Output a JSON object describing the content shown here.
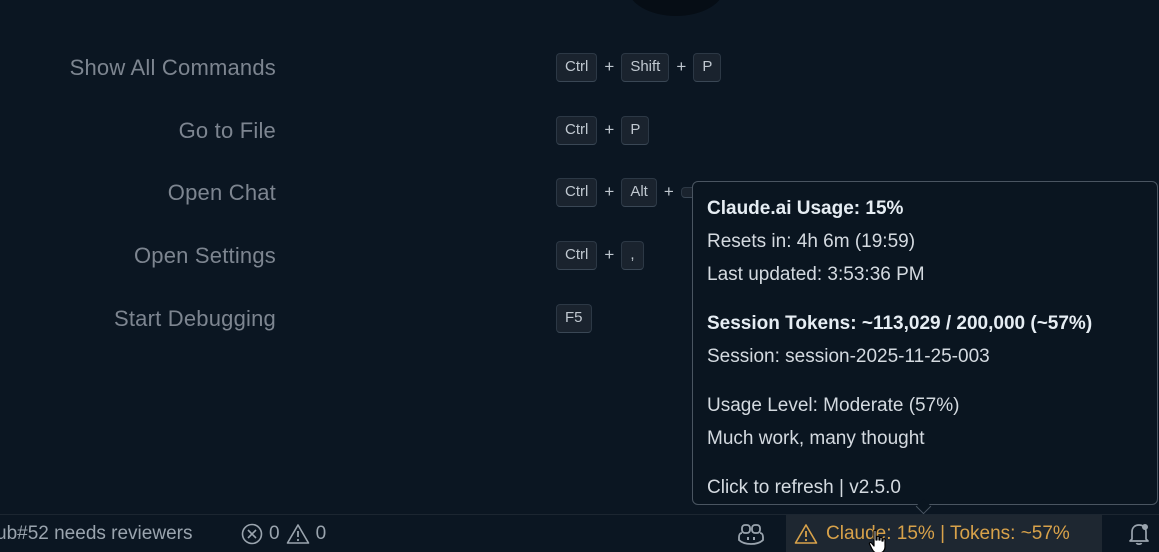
{
  "shortcuts": [
    {
      "label": "Show All Commands",
      "keys": [
        "Ctrl",
        "Shift",
        "P"
      ]
    },
    {
      "label": "Go to File",
      "keys": [
        "Ctrl",
        "P"
      ]
    },
    {
      "label": "Open Chat",
      "keys": [
        "Ctrl",
        "Alt",
        ""
      ]
    },
    {
      "label": "Open Settings",
      "keys": [
        "Ctrl",
        ","
      ]
    },
    {
      "label": "Start Debugging",
      "keys": [
        "F5"
      ]
    }
  ],
  "key_separator": "+",
  "tooltip": {
    "usage_title": "Claude.ai Usage: 15%",
    "resets": "Resets in: 4h 6m (19:59)",
    "last_updated": "Last updated: 3:53:36 PM",
    "session_tokens": "Session Tokens: ~113,029 / 200,000 (~57%)",
    "session": "Session: session-2025-11-25-003",
    "usage_level": "Usage Level: Moderate (57%)",
    "flavor": "Much work, many thought",
    "footer": "Click to refresh | v2.5.0"
  },
  "statusbar": {
    "pr_text": "ub#52 needs reviewers",
    "errors_count": "0",
    "warnings_count": "0",
    "claude_item": "Claude: 15% | Tokens: ~57%",
    "icons": {
      "errors": "error-circle-icon",
      "warnings": "warning-triangle-icon",
      "copilot": "copilot-icon",
      "claude_warning": "warning-triangle-icon",
      "bell": "bell-icon"
    }
  },
  "colors": {
    "background": "#0b1622",
    "claude_item_text": "#d8a24a",
    "claude_item_bg": "#1e2731",
    "tooltip_border": "#4a5561"
  }
}
